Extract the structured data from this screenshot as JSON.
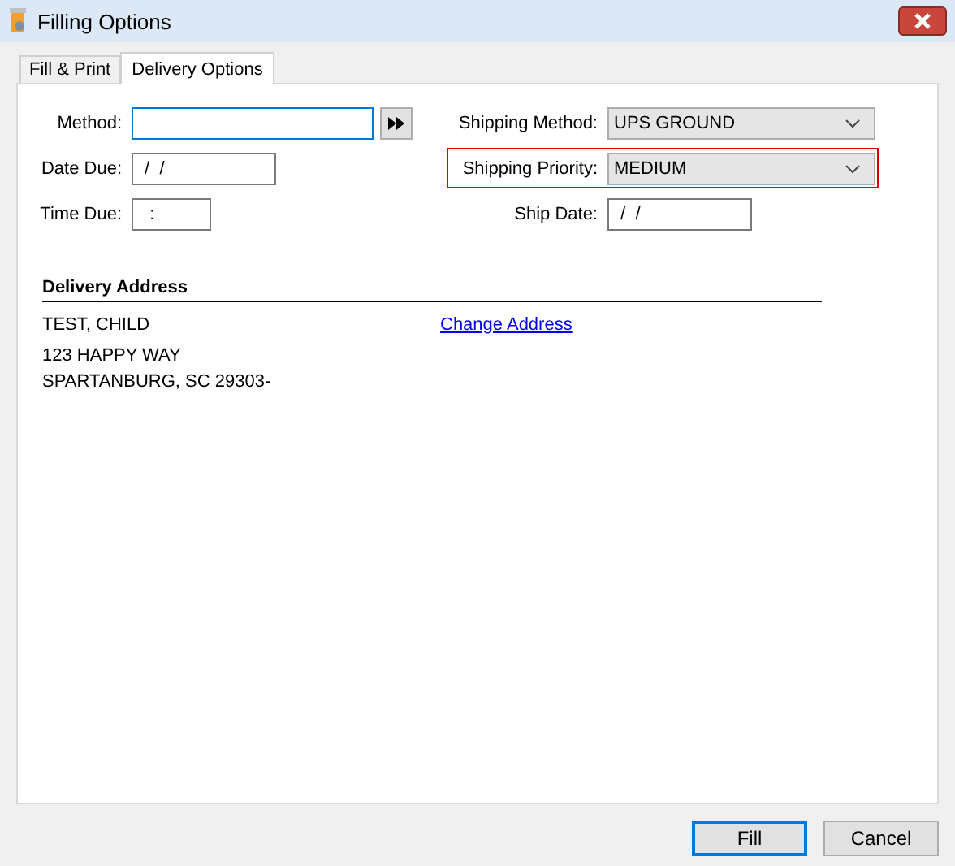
{
  "window": {
    "title": "Filling Options"
  },
  "tabs": [
    {
      "label": "Fill & Print",
      "selected": false
    },
    {
      "label": "Delivery Options",
      "selected": true
    }
  ],
  "left_fields": [
    {
      "label": "Method:",
      "kind": "lookup",
      "focused": true
    },
    {
      "label": "Date Due:",
      "kind": "date",
      "value": " /  /",
      "focused": false
    },
    {
      "label": "Time Due:",
      "kind": "time",
      "value": "  :",
      "focused": false
    }
  ],
  "right_fields": [
    {
      "label": "Shipping Method:",
      "kind": "dropdown",
      "value": "UPS GROUND",
      "highlighted": false
    },
    {
      "label": "Shipping Priority:",
      "kind": "dropdown",
      "value": "MEDIUM",
      "highlighted": true
    },
    {
      "label": "Ship Date:",
      "kind": "text",
      "value": " /  /",
      "highlighted": false
    }
  ],
  "delivery_address": {
    "heading": "Delivery Address",
    "name": "TEST, CHILD",
    "change_link": "Change Address",
    "lines": [
      "123 HAPPY WAY",
      "SPARTANBURG, SC  29303-"
    ]
  },
  "buttons": [
    {
      "label": "Fill",
      "default": true
    },
    {
      "label": "Cancel",
      "default": false
    }
  ]
}
